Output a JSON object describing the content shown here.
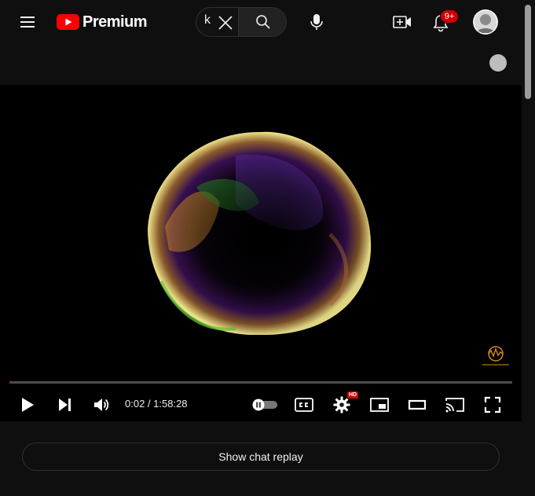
{
  "header": {
    "logo_text": "Premium",
    "search": {
      "value": "k",
      "placeholder": "Search"
    },
    "notification_count": "9+"
  },
  "player": {
    "current_time": "0:02",
    "time_separator": " / ",
    "duration": "1:58:28",
    "progress": 0.0003,
    "settings_badge": "HD",
    "watermark_brand": "SKYMUSIC"
  },
  "chat": {
    "replay_label": "Show chat replay"
  },
  "icons": {
    "menu": "hamburger-menu-icon",
    "clear": "close-icon",
    "search": "search-icon",
    "mic": "microphone-icon",
    "create": "video-plus-icon",
    "notifications": "bell-icon",
    "play": "play-icon",
    "next": "skip-next-icon",
    "volume": "volume-icon",
    "autoplay": "autoplay-toggle-icon",
    "captions": "closed-captions-icon",
    "settings": "gear-icon",
    "miniplayer": "miniplayer-icon",
    "theater": "theater-mode-icon",
    "cast": "cast-icon",
    "fullscreen": "fullscreen-icon"
  },
  "colors": {
    "background": "#0f0f0f",
    "brand_red": "#ff0000",
    "badge_red": "#cc0000",
    "text": "#f1f1f1"
  }
}
